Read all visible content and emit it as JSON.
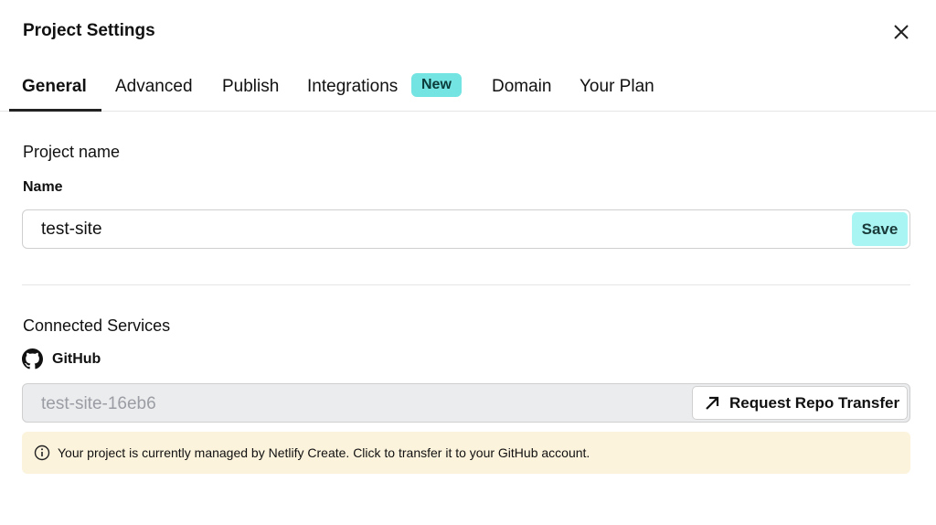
{
  "dialog": {
    "title": "Project Settings"
  },
  "tabs": [
    {
      "label": "General"
    },
    {
      "label": "Advanced"
    },
    {
      "label": "Publish"
    },
    {
      "label": "Integrations"
    },
    {
      "label": "Domain"
    },
    {
      "label": "Your Plan"
    }
  ],
  "badge": "New",
  "project": {
    "heading": "Project name",
    "label": "Name",
    "value": "test-site",
    "save": "Save"
  },
  "services": {
    "heading": "Connected Services",
    "provider": "GitHub",
    "repo": "test-site-16eb6",
    "transfer": "Request Repo Transfer",
    "notice": "Your project is currently managed by Netlify Create. Click to transfer it to your GitHub account."
  }
}
